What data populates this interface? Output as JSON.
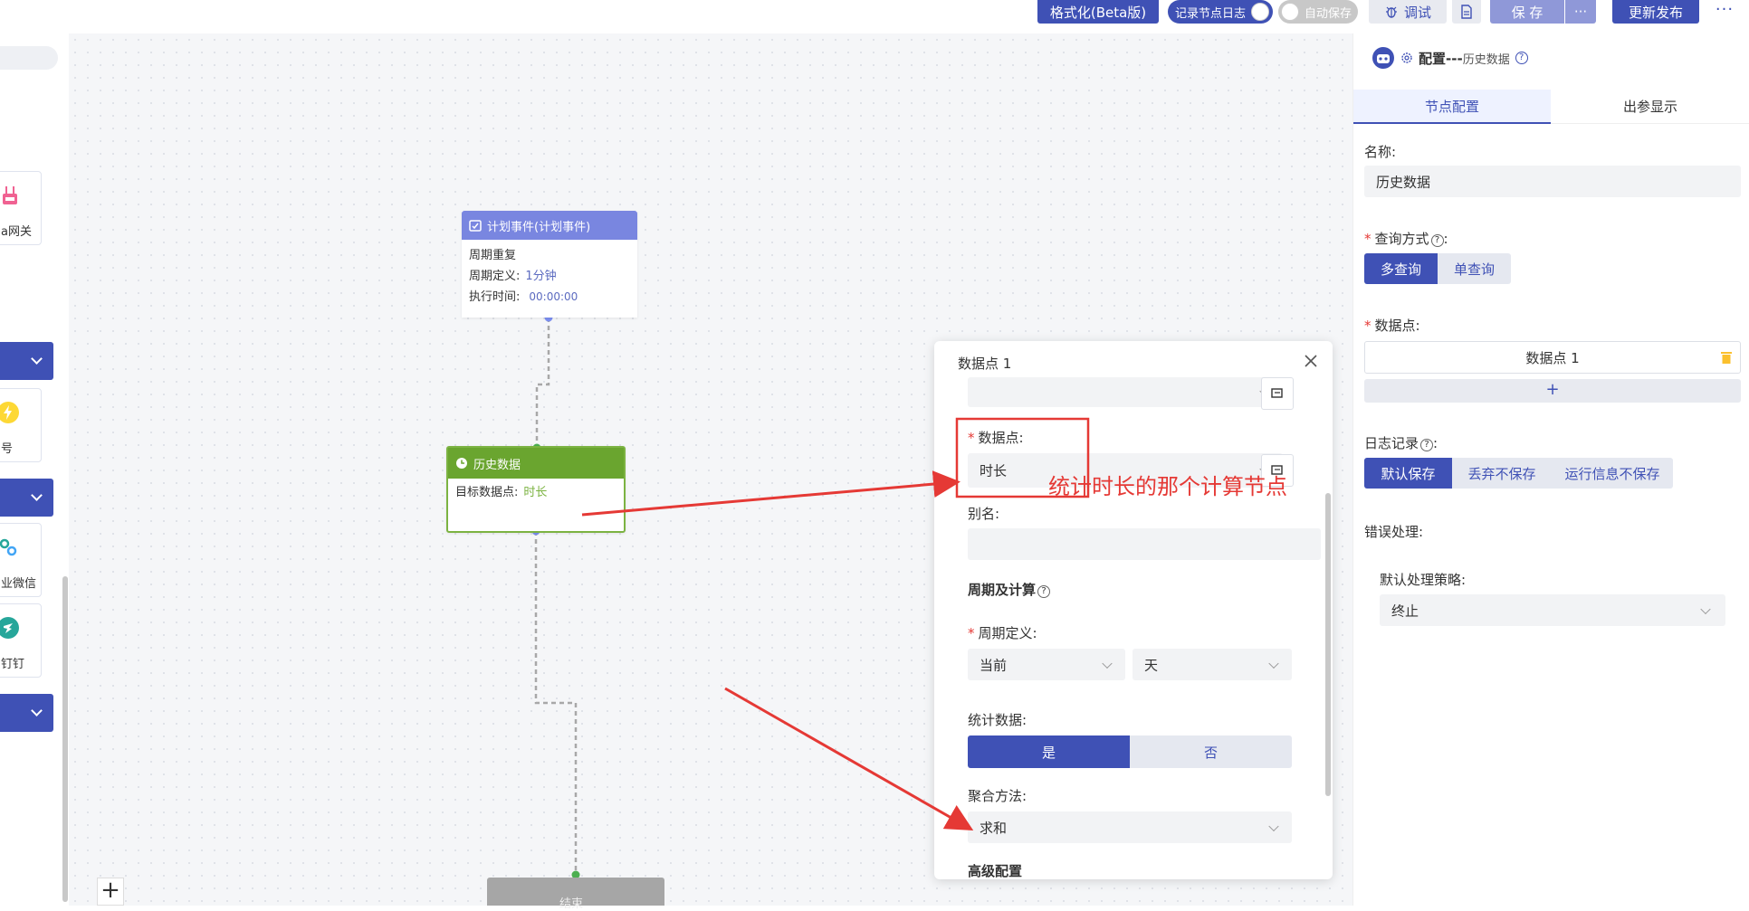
{
  "toolbar": {
    "format_label": "格式化(Beta版)",
    "record_log_label": "记录节点日志",
    "auto_save_label": "自动保存",
    "debug_label": "调试",
    "save_label": "保 存",
    "more_label": "···",
    "publish_label": "更新发布",
    "overflow_label": "⋮"
  },
  "palette": {
    "items": [
      {
        "label": "a网关"
      },
      {
        "label": "号"
      },
      {
        "label": "业微信"
      },
      {
        "label": "钉钉"
      }
    ]
  },
  "nodes": {
    "plan": {
      "title": "计划事件(计划事件)",
      "row1": "周期重复",
      "row2_label": "周期定义:",
      "row2_value": "1分钟",
      "row3_label": "执行时间:",
      "row3_value": "00:00:00"
    },
    "history": {
      "title": "历史数据",
      "row1_label": "目标数据点:",
      "row1_value": "时长"
    },
    "bottom": {
      "title": "结束"
    }
  },
  "dialog": {
    "title": "数据点 1",
    "datapoint_label": "数据点:",
    "datapoint_value": "时长",
    "alias_label": "别名:",
    "cycle_section": "周期及计算",
    "cycle_def_label": "周期定义:",
    "cycle_value": "当前",
    "cycle_unit": "天",
    "stat_label": "统计数据:",
    "stat_yes": "是",
    "stat_no": "否",
    "agg_label": "聚合方法:",
    "agg_value": "求和",
    "advanced_label": "高级配置"
  },
  "annotation": {
    "text": "统计时长的那个计算节点",
    "color": "#e53935"
  },
  "panel": {
    "title_prefix": "配置---",
    "title_node": "历史数据",
    "tabs": [
      "节点配置",
      "出参显示"
    ],
    "name_label": "名称:",
    "name_value": "历史数据",
    "query_label": "查询方式",
    "query_options": [
      "多查询",
      "单查询"
    ],
    "datapoint_label": "数据点:",
    "datapoint_item": "数据点 1",
    "add_symbol": "+",
    "log_label": "日志记录",
    "log_options": [
      "默认保存",
      "丢弃不保存",
      "运行信息不保存"
    ],
    "error_label": "错误处理:",
    "policy_label": "默认处理策略:",
    "policy_value": "终止"
  },
  "colors": {
    "primary": "#3f51b5",
    "node_plan": "#7986e0",
    "node_history": "#6aa52f",
    "annotation": "#e53935"
  }
}
